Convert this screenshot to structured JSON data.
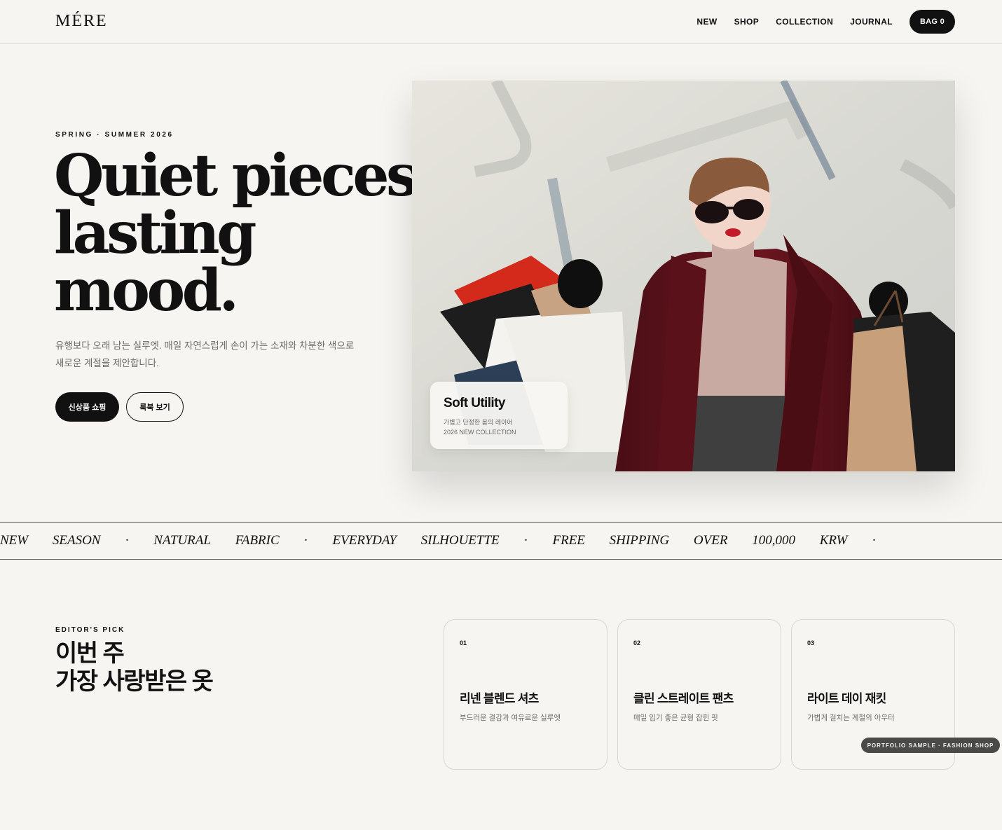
{
  "header": {
    "logo": "MÉRE",
    "nav": [
      "NEW",
      "SHOP",
      "COLLECTION",
      "JOURNAL"
    ],
    "bag_label": "BAG 0"
  },
  "hero": {
    "eyebrow": "SPRING · SUMMER 2026",
    "title_lines": [
      "Quiet pieces,",
      "lasting",
      "mood."
    ],
    "description": "유행보다 오래 남는 실루엣. 매일 자연스럽게 손이 가는 소재와 차분한 색으로 새로운 계절을 제안합니다.",
    "primary_button": "신상품 쇼핑",
    "secondary_button": "룩북 보기",
    "card": {
      "title": "Soft Utility",
      "line1": "가볍고 단정한 봄의 레이어",
      "line2": "2026 NEW COLLECTION"
    }
  },
  "marquee": {
    "items": [
      "NEW",
      "SEASON",
      "·",
      "NATURAL",
      "FABRIC",
      "·",
      "EVERYDAY",
      "SILHOUETTE",
      "·",
      "FREE",
      "SHIPPING",
      "OVER",
      "100,000",
      "KRW",
      "·"
    ]
  },
  "editors_pick": {
    "eyebrow": "EDITOR'S PICK",
    "title_lines": [
      "이번 주",
      "가장 사랑받은 옷"
    ],
    "cards": [
      {
        "num": "01",
        "title": "리넨 블렌드 셔츠",
        "desc": "부드러운 결감과 여유로운 실루엣"
      },
      {
        "num": "02",
        "title": "클린 스트레이트 팬츠",
        "desc": "매일 입기 좋은 균형 잡힌 핏"
      },
      {
        "num": "03",
        "title": "라이트 데이 재킷",
        "desc": "가볍게 걸치는 계절의 아우터"
      }
    ]
  },
  "badge": "PORTFOLIO SAMPLE · FASHION SHOP"
}
